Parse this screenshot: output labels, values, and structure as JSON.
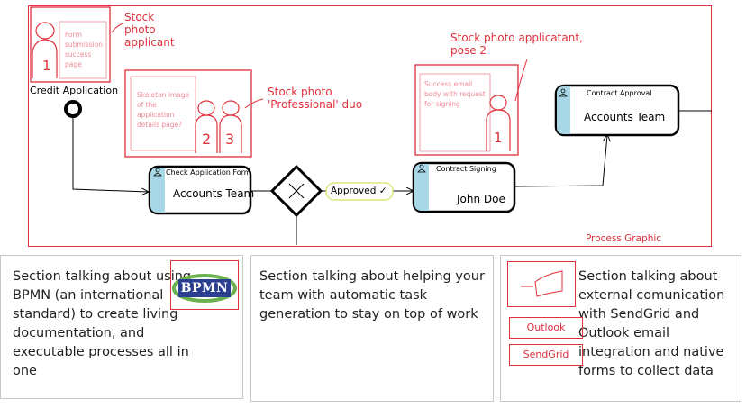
{
  "process_graphic": {
    "label": "Process Graphic",
    "annotations": {
      "applicant": "Stock photo applicant",
      "duo": "Stock photo 'Professional' duo",
      "applicant_pose2_line1": "Stock photo applicatant,",
      "applicant_pose2_line2": "pose 2"
    },
    "image_placeholders": {
      "form_success": "Form submission success page",
      "skeleton": "Skeleton image of the application details page?",
      "success_email": "Success email body with request for signing"
    },
    "start_event_label": "Credit Application",
    "gateway_flow_label": "Approved ✓",
    "tasks": [
      {
        "title": "Check Application Form",
        "name": "Accounts Team"
      },
      {
        "title": "Contract Signing",
        "name": "John Doe"
      },
      {
        "title": "Contract Approval",
        "name": "Accounts Team"
      }
    ],
    "figure_numbers": [
      "1",
      "2",
      "3",
      "1"
    ]
  },
  "sections": [
    {
      "text": "Section talking about using BPMN (an international standard) to create living documentation, and executable processes all in one",
      "logo_text": "BPMN"
    },
    {
      "text": "Section talking about helping your team with automatic task generation to stay on top of work"
    },
    {
      "text": "Section talking about external comunication with SendGrid and Outlook email integration and native forms to collect data",
      "buttons": [
        "Outlook",
        "SendGrid"
      ]
    }
  ],
  "colors": {
    "accent_red": "#e0303c",
    "task_accent": "#a8d8e8",
    "approved_border": "#d8e060"
  }
}
